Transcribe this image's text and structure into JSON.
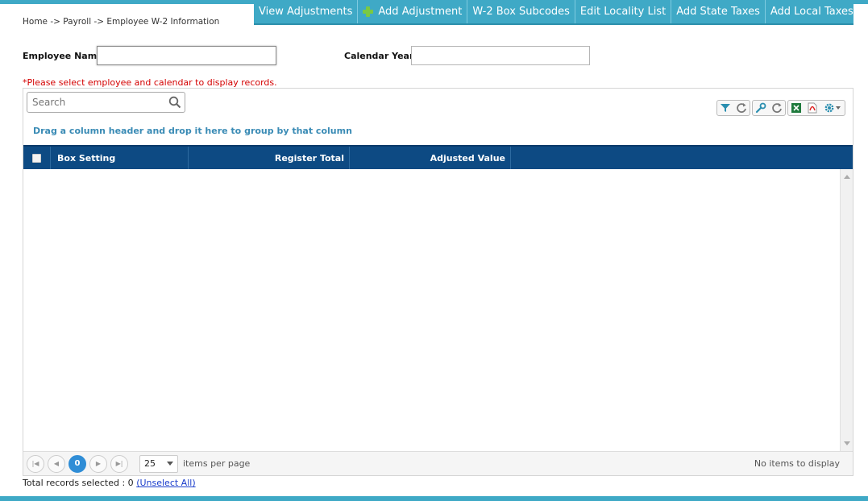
{
  "toolbar": {
    "view_adjustments": "View Adjustments",
    "add_adjustment": "Add Adjustment",
    "w2_box_subcodes": "W-2 Box Subcodes",
    "edit_locality_list": "Edit Locality List",
    "add_state_taxes": "Add State Taxes",
    "add_local_taxes": "Add Local Taxes"
  },
  "breadcrumb": "Home -> Payroll -> Employee W-2 Information",
  "form": {
    "employee_name_label": "Employee Name",
    "employee_name_value": "",
    "calendar_year_label": "Calendar Year",
    "calendar_year_value": ""
  },
  "warning": "*Please select employee and calendar to display records.",
  "grid": {
    "search_placeholder": "Search",
    "group_hint": "Drag a column header and drop it here to group by that column",
    "columns": [
      "Box Setting",
      "Register Total",
      "Adjusted Value"
    ],
    "rows": [],
    "icons": [
      "filter-icon",
      "refresh-icon",
      "wrench-icon",
      "refresh-icon",
      "excel-icon",
      "pdf-icon",
      "gear-icon"
    ]
  },
  "pager": {
    "current_page": "0",
    "page_size": "25",
    "items_per_page_label": "items per page",
    "empty_message": "No items to display"
  },
  "totals": {
    "label": "Total records selected : 0",
    "unselect_link": "(Unselect All)"
  },
  "colors": {
    "accent": "#3fa9c6",
    "header": "#0d4a83",
    "warning": "#d40000",
    "link": "#3a8bb5"
  }
}
